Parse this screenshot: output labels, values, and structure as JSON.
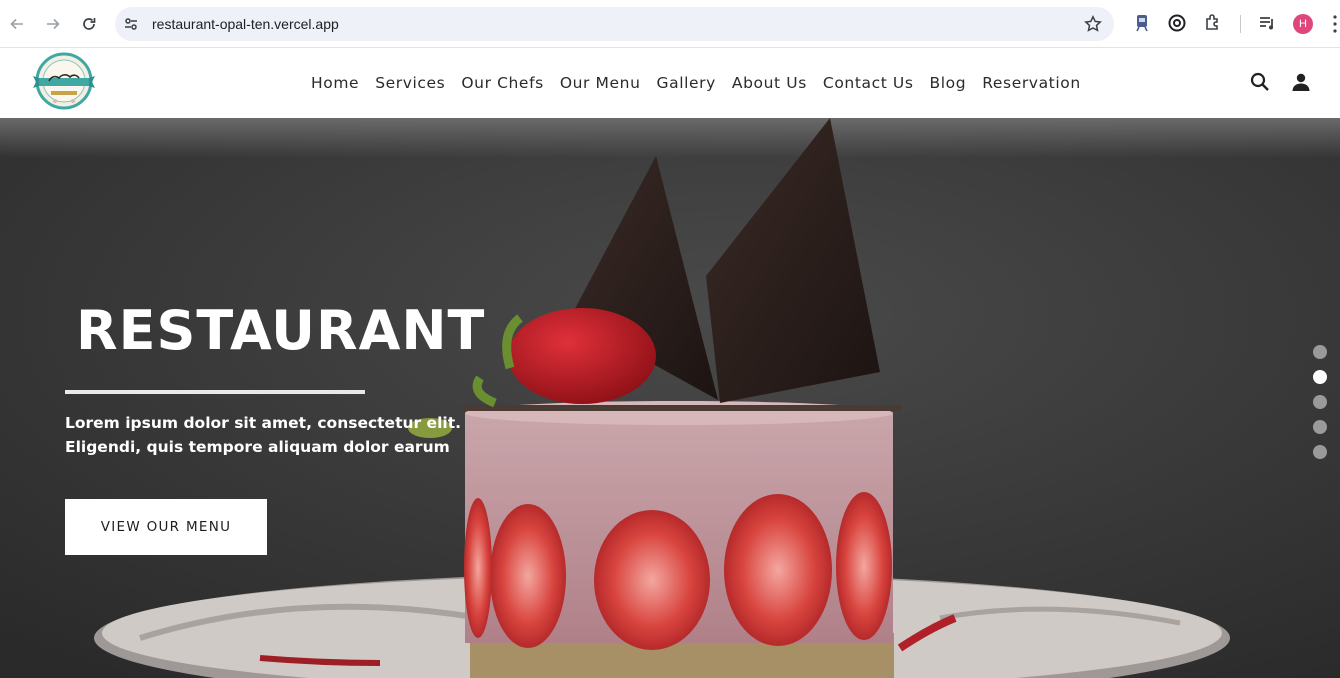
{
  "browser": {
    "url": "restaurant-opal-ten.vercel.app",
    "profile_initial": "H"
  },
  "header": {
    "nav": [
      {
        "label": "Home"
      },
      {
        "label": "Services"
      },
      {
        "label": "Our Chefs"
      },
      {
        "label": "Our Menu"
      },
      {
        "label": "Gallery"
      },
      {
        "label": "About Us"
      },
      {
        "label": "Contact Us"
      },
      {
        "label": "Blog"
      },
      {
        "label": "Reservation"
      }
    ],
    "icons": [
      "search-icon",
      "user-icon"
    ]
  },
  "hero": {
    "title": "RESTAURANT",
    "subtitle": "Lorem ipsum dolor sit amet, consectetur elit. Eligendi, quis tempore aliquam dolor earum",
    "cta_label": "VIEW OUR MENU",
    "slide_count": 5,
    "active_slide": 2
  },
  "colors": {
    "profile": "#e0457b",
    "hero_overlay": "#3b3b3b"
  }
}
